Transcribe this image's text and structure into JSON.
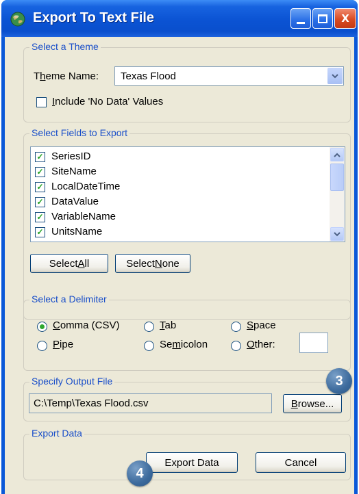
{
  "window": {
    "title": "Export To Text File",
    "controls": {
      "minimize": "",
      "maximize": "",
      "close": "X"
    }
  },
  "theme_group": {
    "label": "Select a Theme",
    "theme_name_label": {
      "pre": "T",
      "mnemonic": "h",
      "post": "eme Name:"
    },
    "theme_value": "Texas Flood",
    "include_no_data": {
      "pre": "",
      "mnemonic": "I",
      "post": "nclude 'No Data' Values",
      "checked": false
    }
  },
  "fields_group": {
    "label": "Select Fields to Export",
    "fields": [
      {
        "name": "SeriesID",
        "checked": true
      },
      {
        "name": "SiteName",
        "checked": true
      },
      {
        "name": "LocalDateTime",
        "checked": true
      },
      {
        "name": "DataValue",
        "checked": true
      },
      {
        "name": "VariableName",
        "checked": true
      },
      {
        "name": "UnitsName",
        "checked": true
      }
    ],
    "select_all": {
      "pre": "Select ",
      "mnemonic": "A",
      "post": "ll"
    },
    "select_none": {
      "pre": "Select ",
      "mnemonic": "N",
      "post": "one"
    }
  },
  "delimiter_group": {
    "label": "Select a Delimiter",
    "options": [
      {
        "pre": "",
        "mnemonic": "C",
        "post": "omma (CSV)",
        "selected": true
      },
      {
        "pre": "",
        "mnemonic": "T",
        "post": "ab",
        "selected": false
      },
      {
        "pre": "",
        "mnemonic": "S",
        "post": "pace",
        "selected": false
      },
      {
        "pre": "",
        "mnemonic": "P",
        "post": "ipe",
        "selected": false
      },
      {
        "pre": "Se",
        "mnemonic": "m",
        "post": "icolon",
        "selected": false
      },
      {
        "pre": "",
        "mnemonic": "O",
        "post": "ther:",
        "selected": false
      }
    ],
    "other_value": ""
  },
  "output_group": {
    "label": "Specify Output File",
    "path": "C:\\Temp\\Texas Flood.csv",
    "browse": {
      "pre": "",
      "mnemonic": "B",
      "post": "rowse..."
    }
  },
  "export_group": {
    "label": "Export Data",
    "export_button": "Export Data",
    "cancel_button": "Cancel"
  },
  "callouts": [
    "3",
    "4"
  ],
  "colors": {
    "titlebar": "#0b53d3",
    "group_label": "#1a4fc9",
    "dialog_bg": "#ece9d8",
    "check_mark": "#21a121",
    "callout": "#3c6a9c"
  }
}
